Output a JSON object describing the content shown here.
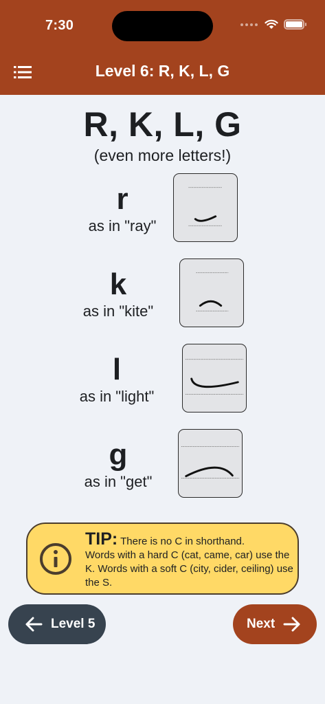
{
  "status_bar": {
    "time": "7:30"
  },
  "header": {
    "title": "Level 6: R, K, L, G",
    "menu_icon": "list-icon"
  },
  "lesson": {
    "heading": "R, K, L, G",
    "subheading": "(even more letters!)",
    "letters": [
      {
        "glyph": "r",
        "example": "as in \"ray\""
      },
      {
        "glyph": "k",
        "example": "as in \"kite\""
      },
      {
        "glyph": "l",
        "example": "as in \"light\""
      },
      {
        "glyph": "g",
        "example": "as in \"get\""
      }
    ]
  },
  "tip": {
    "label": "TIP:",
    "lead": "There is no C in shorthand.",
    "body": "Words with a hard C (cat, came, car) use the K. Words with a soft C (city, cider, ceiling) use the S.",
    "icon": "info-icon"
  },
  "nav": {
    "prev_label": "Level 5",
    "prev_icon": "arrow-left-icon",
    "next_label": "Next",
    "next_icon": "arrow-right-icon"
  },
  "colors": {
    "header": "#a3431e",
    "background": "#eff2f7",
    "tip_background": "#ffd966",
    "prev_button": "#37434f",
    "next_button": "#a3431e"
  }
}
